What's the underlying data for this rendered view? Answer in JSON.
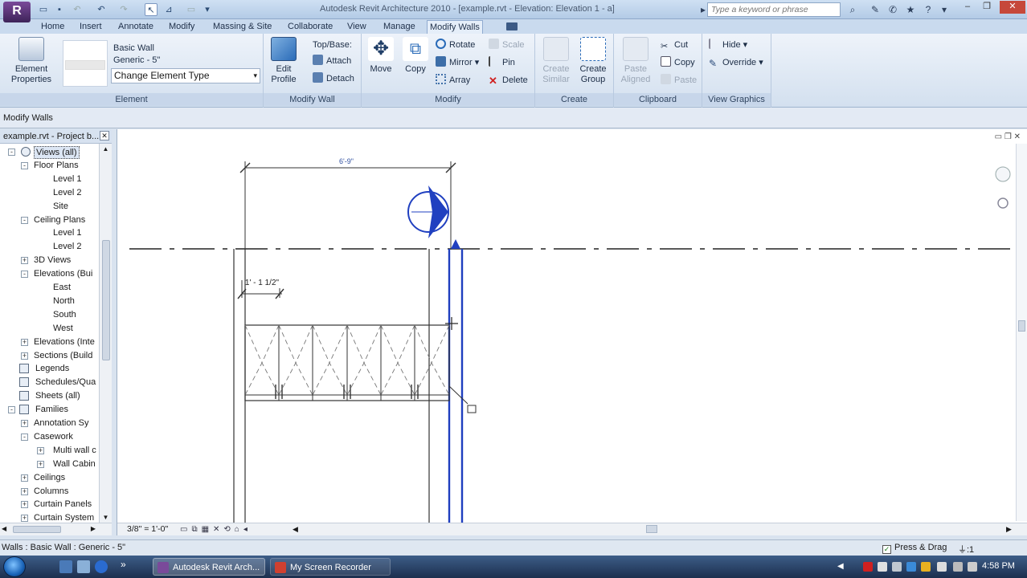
{
  "titlebar": {
    "app_button": "R",
    "title": "Autodesk Revit Architecture 2010 - [example.rvt - Elevation: Elevation 1 - a]",
    "search_placeholder": "Type a keyword or phrase"
  },
  "tabs": [
    "Home",
    "Insert",
    "Annotate",
    "Modify",
    "Massing & Site",
    "Collaborate",
    "View",
    "Manage",
    "Modify Walls"
  ],
  "ribbon": {
    "element": {
      "title": "Element",
      "properties_label": "Element Properties",
      "type_family": "Basic Wall",
      "type_name": "Generic - 5\"",
      "change_type_label": "Change Element Type"
    },
    "modify_wall": {
      "title": "Modify Wall",
      "edit_profile": "Edit Profile",
      "top_base": "Top/Base:",
      "attach": "Attach",
      "detach": "Detach"
    },
    "modify": {
      "title": "Modify",
      "move": "Move",
      "copy": "Copy",
      "rotate": "Rotate",
      "mirror": "Mirror",
      "array": "Array",
      "scale": "Scale",
      "pin": "Pin",
      "delete": "Delete"
    },
    "create": {
      "title": "Create",
      "create_similar": "Create Similar",
      "create_group": "Create Group"
    },
    "clipboard": {
      "title": "Clipboard",
      "paste_aligned": "Paste Aligned",
      "cut": "Cut",
      "copy": "Copy",
      "paste": "Paste"
    },
    "view_graphics": {
      "title": "View Graphics",
      "hide": "Hide",
      "override": "Override"
    }
  },
  "options_bar": {
    "label": "Modify Walls"
  },
  "browser": {
    "title": "example.rvt - Project b...",
    "items": [
      {
        "label": "Views (all)",
        "level": 0,
        "toggle": "-"
      },
      {
        "label": "Floor Plans",
        "level": 1,
        "toggle": "-"
      },
      {
        "label": "Level 1",
        "level": 2,
        "toggle": ""
      },
      {
        "label": "Level 2",
        "level": 2,
        "toggle": ""
      },
      {
        "label": "Site",
        "level": 2,
        "toggle": ""
      },
      {
        "label": "Ceiling Plans",
        "level": 1,
        "toggle": "-"
      },
      {
        "label": "Level 1",
        "level": 2,
        "toggle": ""
      },
      {
        "label": "Level 2",
        "level": 2,
        "toggle": ""
      },
      {
        "label": "3D Views",
        "level": 1,
        "toggle": "+"
      },
      {
        "label": "Elevations (Bui",
        "level": 1,
        "toggle": "-"
      },
      {
        "label": "East",
        "level": 2,
        "toggle": ""
      },
      {
        "label": "North",
        "level": 2,
        "toggle": ""
      },
      {
        "label": "South",
        "level": 2,
        "toggle": ""
      },
      {
        "label": "West",
        "level": 2,
        "toggle": ""
      },
      {
        "label": "Elevations (Inte",
        "level": 1,
        "toggle": "+"
      },
      {
        "label": "Sections (Build",
        "level": 1,
        "toggle": "+"
      },
      {
        "label": "Legends",
        "level": 0,
        "toggle": ""
      },
      {
        "label": "Schedules/Qua",
        "level": 0,
        "toggle": ""
      },
      {
        "label": "Sheets (all)",
        "level": 0,
        "toggle": ""
      },
      {
        "label": "Families",
        "level": 0,
        "toggle": "-"
      },
      {
        "label": "Annotation Sy",
        "level": 1,
        "toggle": "+"
      },
      {
        "label": "Casework",
        "level": 1,
        "toggle": "-"
      },
      {
        "label": "Multi wall c",
        "level": 2,
        "toggle": "+"
      },
      {
        "label": "Wall Cabin",
        "level": 2,
        "toggle": "+"
      },
      {
        "label": "Ceilings",
        "level": 1,
        "toggle": "+"
      },
      {
        "label": "Columns",
        "level": 1,
        "toggle": "+"
      },
      {
        "label": "Curtain Panels",
        "level": 1,
        "toggle": "+"
      },
      {
        "label": "Curtain System",
        "level": 1,
        "toggle": "+"
      }
    ]
  },
  "drawing": {
    "top_dimension": "6'-9\"",
    "side_dimension": "1' - 1 1/2\""
  },
  "view_control": {
    "scale": "3/8\" = 1'-0\""
  },
  "status": {
    "text": "Walls : Basic Wall : Generic - 5\"",
    "press_drag": "Press & Drag",
    "filter_count": ":1"
  },
  "taskbar": {
    "items": [
      "Autodesk Revit Arch...",
      "My Screen Recorder"
    ],
    "clock": "4:58 PM"
  },
  "colors": {
    "accent": "#2b5fb3",
    "selection_blue": "#1f3fbf"
  }
}
